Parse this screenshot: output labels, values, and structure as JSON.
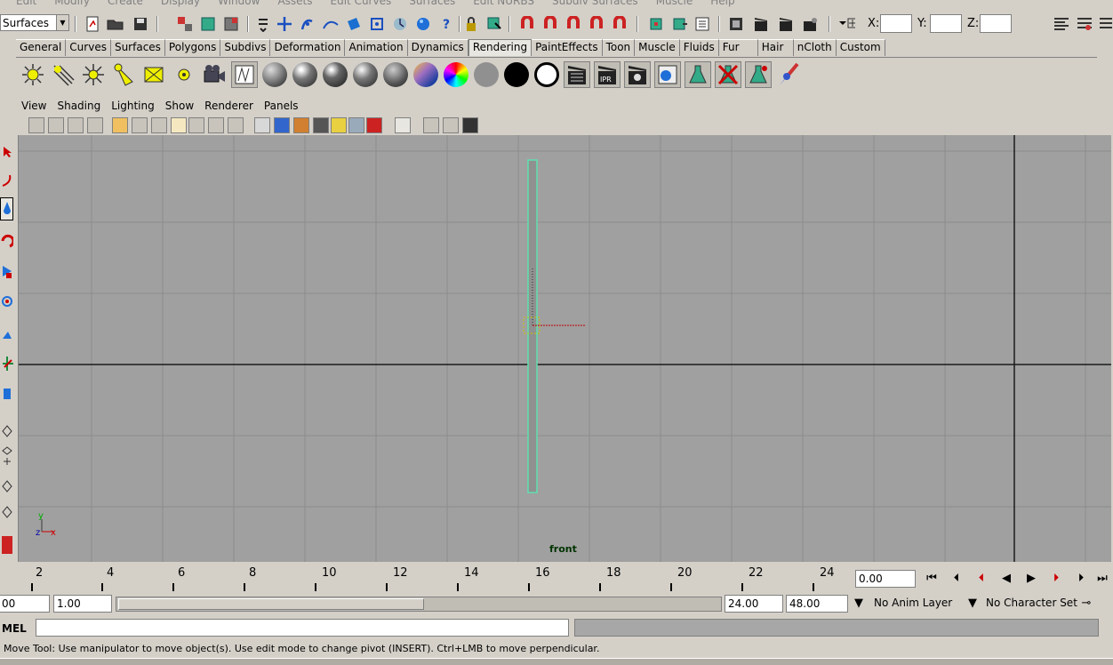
{
  "menubar": [
    "Edit",
    "Modify",
    "Create",
    "Display",
    "Window",
    "Assets",
    "Edit Curves",
    "Surfaces",
    "Edit NURBS",
    "Subdiv Surfaces",
    "Muscle",
    "Help"
  ],
  "statusline": {
    "menuset_value": "Surfaces",
    "x_label": "X:",
    "y_label": "Y:",
    "z_label": "Z:"
  },
  "shelf_tabs": [
    "General",
    "Curves",
    "Surfaces",
    "Polygons",
    "Subdivs",
    "Deformation",
    "Animation",
    "Dynamics",
    "Rendering",
    "PaintEffects",
    "Toon",
    "Muscle",
    "Fluids",
    "Fur",
    "Hair",
    "nCloth",
    "Custom"
  ],
  "active_shelf_tab": "Rendering",
  "panel_menu": [
    "View",
    "Shading",
    "Lighting",
    "Show",
    "Renderer",
    "Panels"
  ],
  "viewport": {
    "camera_label": "front",
    "axis_y": "y",
    "axis_z": "z",
    "axis_x": "x"
  },
  "timeline": {
    "ticks": [
      "2",
      "4",
      "6",
      "8",
      "10",
      "12",
      "14",
      "16",
      "18",
      "20",
      "22",
      "24"
    ],
    "current_time": "0.00"
  },
  "range": {
    "start_time": "00",
    "playback_start": "1.00",
    "playback_end": "24.00",
    "end_time": "48.00",
    "anim_layer": "No Anim Layer",
    "character_set": "No Character Set"
  },
  "commandline": {
    "language": "MEL"
  },
  "helpline": "Move Tool: Use manipulator to move object(s). Use edit mode to change pivot (INSERT).  Ctrl+LMB to move perpendicular."
}
